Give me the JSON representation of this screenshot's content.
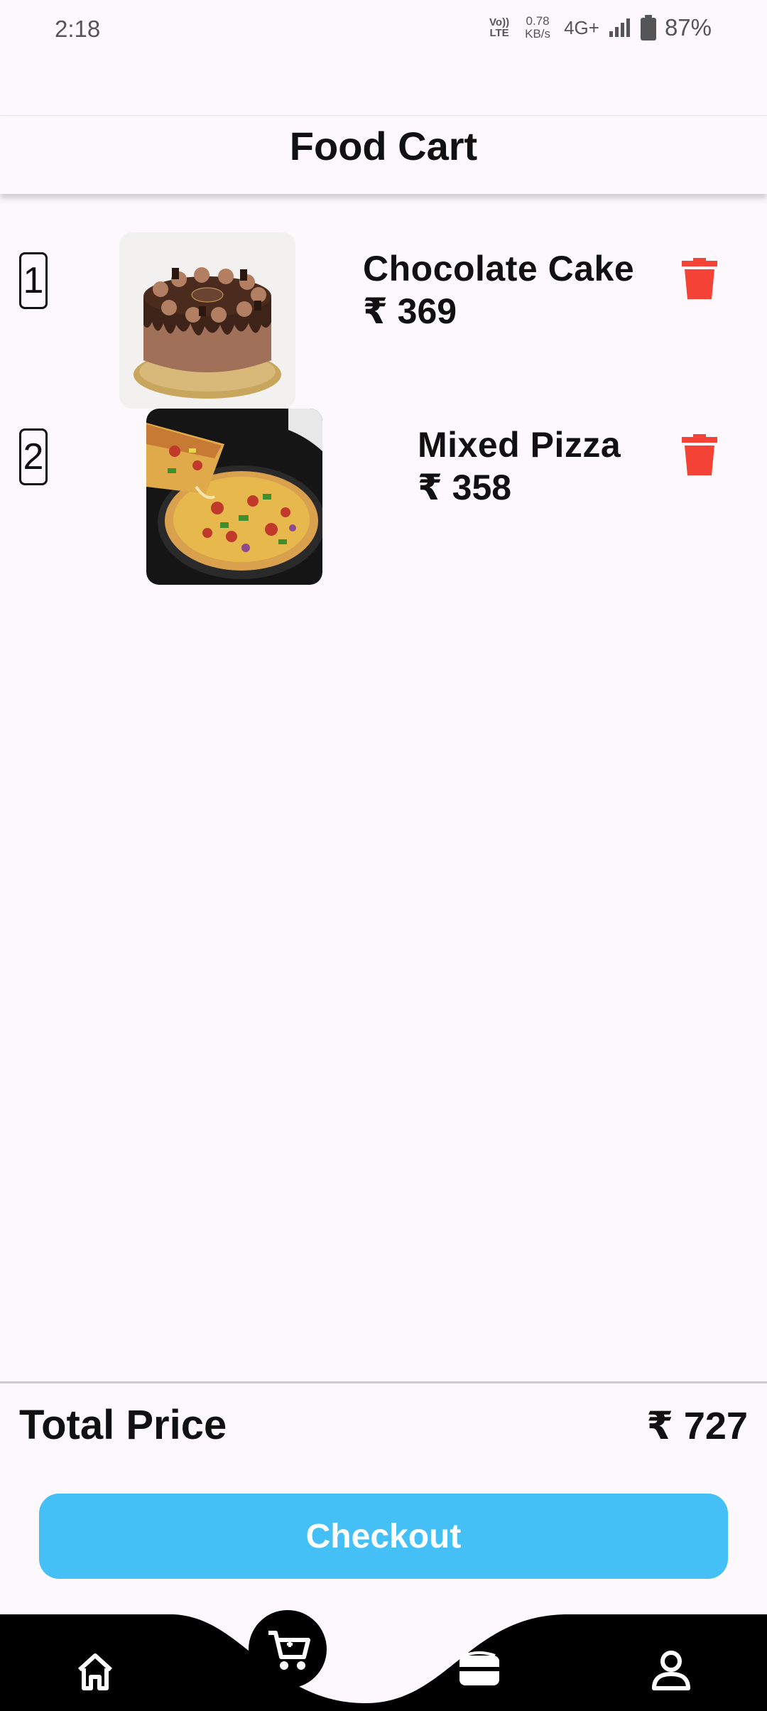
{
  "status_bar": {
    "time": "2:18",
    "volte_line1": "Vo))",
    "volte_line2": "LTE",
    "speed_value": "0.78",
    "speed_unit": "KB/s",
    "network": "4G+",
    "battery": "87%"
  },
  "app_bar": {
    "title": "Food Cart"
  },
  "cart_items": [
    {
      "quantity": "1",
      "name": "Chocolate Cake",
      "price": "₹ 369",
      "image": "chocolate-cake-photo"
    },
    {
      "quantity": "2",
      "name": "Mixed Pizza",
      "price": "₹ 358",
      "image": "mixed-pizza-photo"
    }
  ],
  "totals": {
    "label": "Total Price",
    "value": "₹ 727"
  },
  "checkout": {
    "label": "Checkout"
  },
  "bottom_nav": {
    "items": [
      {
        "icon": "home-icon"
      },
      {
        "icon": "cart-icon",
        "active": true
      },
      {
        "icon": "wallet-icon"
      },
      {
        "icon": "profile-icon"
      }
    ]
  },
  "colors": {
    "accent": "#45c0f6",
    "delete": "#f44336",
    "nav_background": "#000000",
    "page_background": "#fdf8fb"
  }
}
